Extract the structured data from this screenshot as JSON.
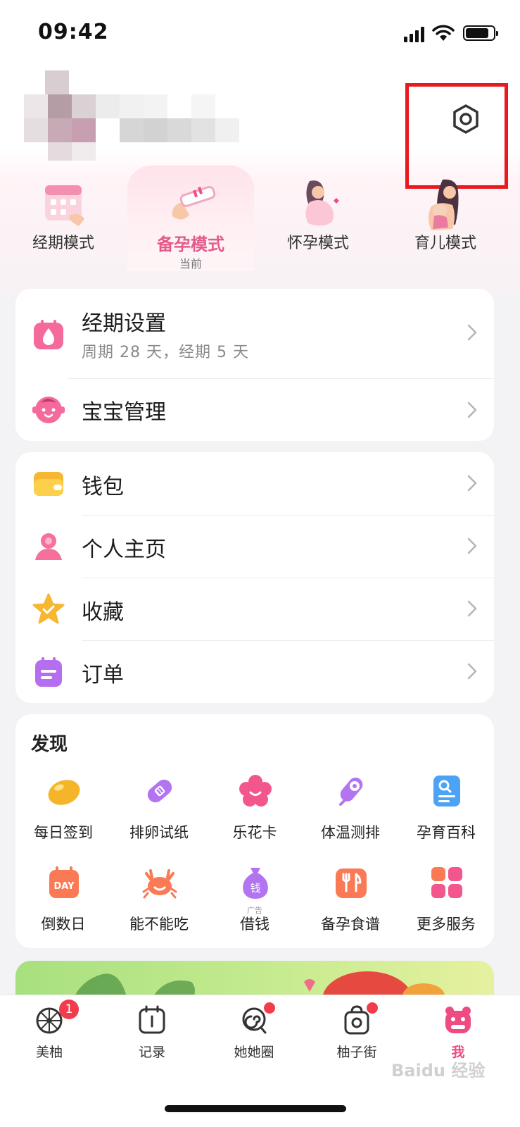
{
  "status_bar": {
    "time": "09:42"
  },
  "modes": [
    {
      "label": "经期模式",
      "sub": ""
    },
    {
      "label": "备孕模式",
      "sub": "当前"
    },
    {
      "label": "怀孕模式",
      "sub": ""
    },
    {
      "label": "育儿模式",
      "sub": ""
    }
  ],
  "settings_card": {
    "period": {
      "title": "经期设置",
      "sub": "周期 28 天，经期 5 天"
    },
    "baby": {
      "title": "宝宝管理"
    }
  },
  "account_card": [
    {
      "title": "钱包",
      "icon": "wallet-icon"
    },
    {
      "title": "个人主页",
      "icon": "person-icon"
    },
    {
      "title": "收藏",
      "icon": "star-icon"
    },
    {
      "title": "订单",
      "icon": "order-icon"
    }
  ],
  "discover": {
    "title": "发现",
    "items": [
      {
        "label": "每日签到",
        "icon": "bean-icon"
      },
      {
        "label": "排卵试纸",
        "icon": "ovulation-strip-icon"
      },
      {
        "label": "乐花卡",
        "icon": "flower-card-icon"
      },
      {
        "label": "体温测排",
        "icon": "thermometer-icon"
      },
      {
        "label": "孕育百科",
        "icon": "encyclopedia-icon"
      },
      {
        "label": "倒数日",
        "icon": "countdown-icon",
        "icon_text": "DAY"
      },
      {
        "label": "能不能吃",
        "icon": "crab-icon"
      },
      {
        "label": "借钱",
        "icon": "money-bag-icon",
        "icon_text": "钱",
        "tag": "广告"
      },
      {
        "label": "备孕食谱",
        "icon": "recipe-icon"
      },
      {
        "label": "更多服务",
        "icon": "more-services-icon"
      }
    ]
  },
  "tab_bar": [
    {
      "label": "美柚",
      "badge": "1"
    },
    {
      "label": "记录"
    },
    {
      "label": "她她圈"
    },
    {
      "label": "柚子街"
    },
    {
      "label": "我"
    }
  ],
  "watermark": "Baidu 经验",
  "colors": {
    "accent": "#e45a8c",
    "highlight": "#e8191f",
    "badge": "#f23b4b"
  }
}
